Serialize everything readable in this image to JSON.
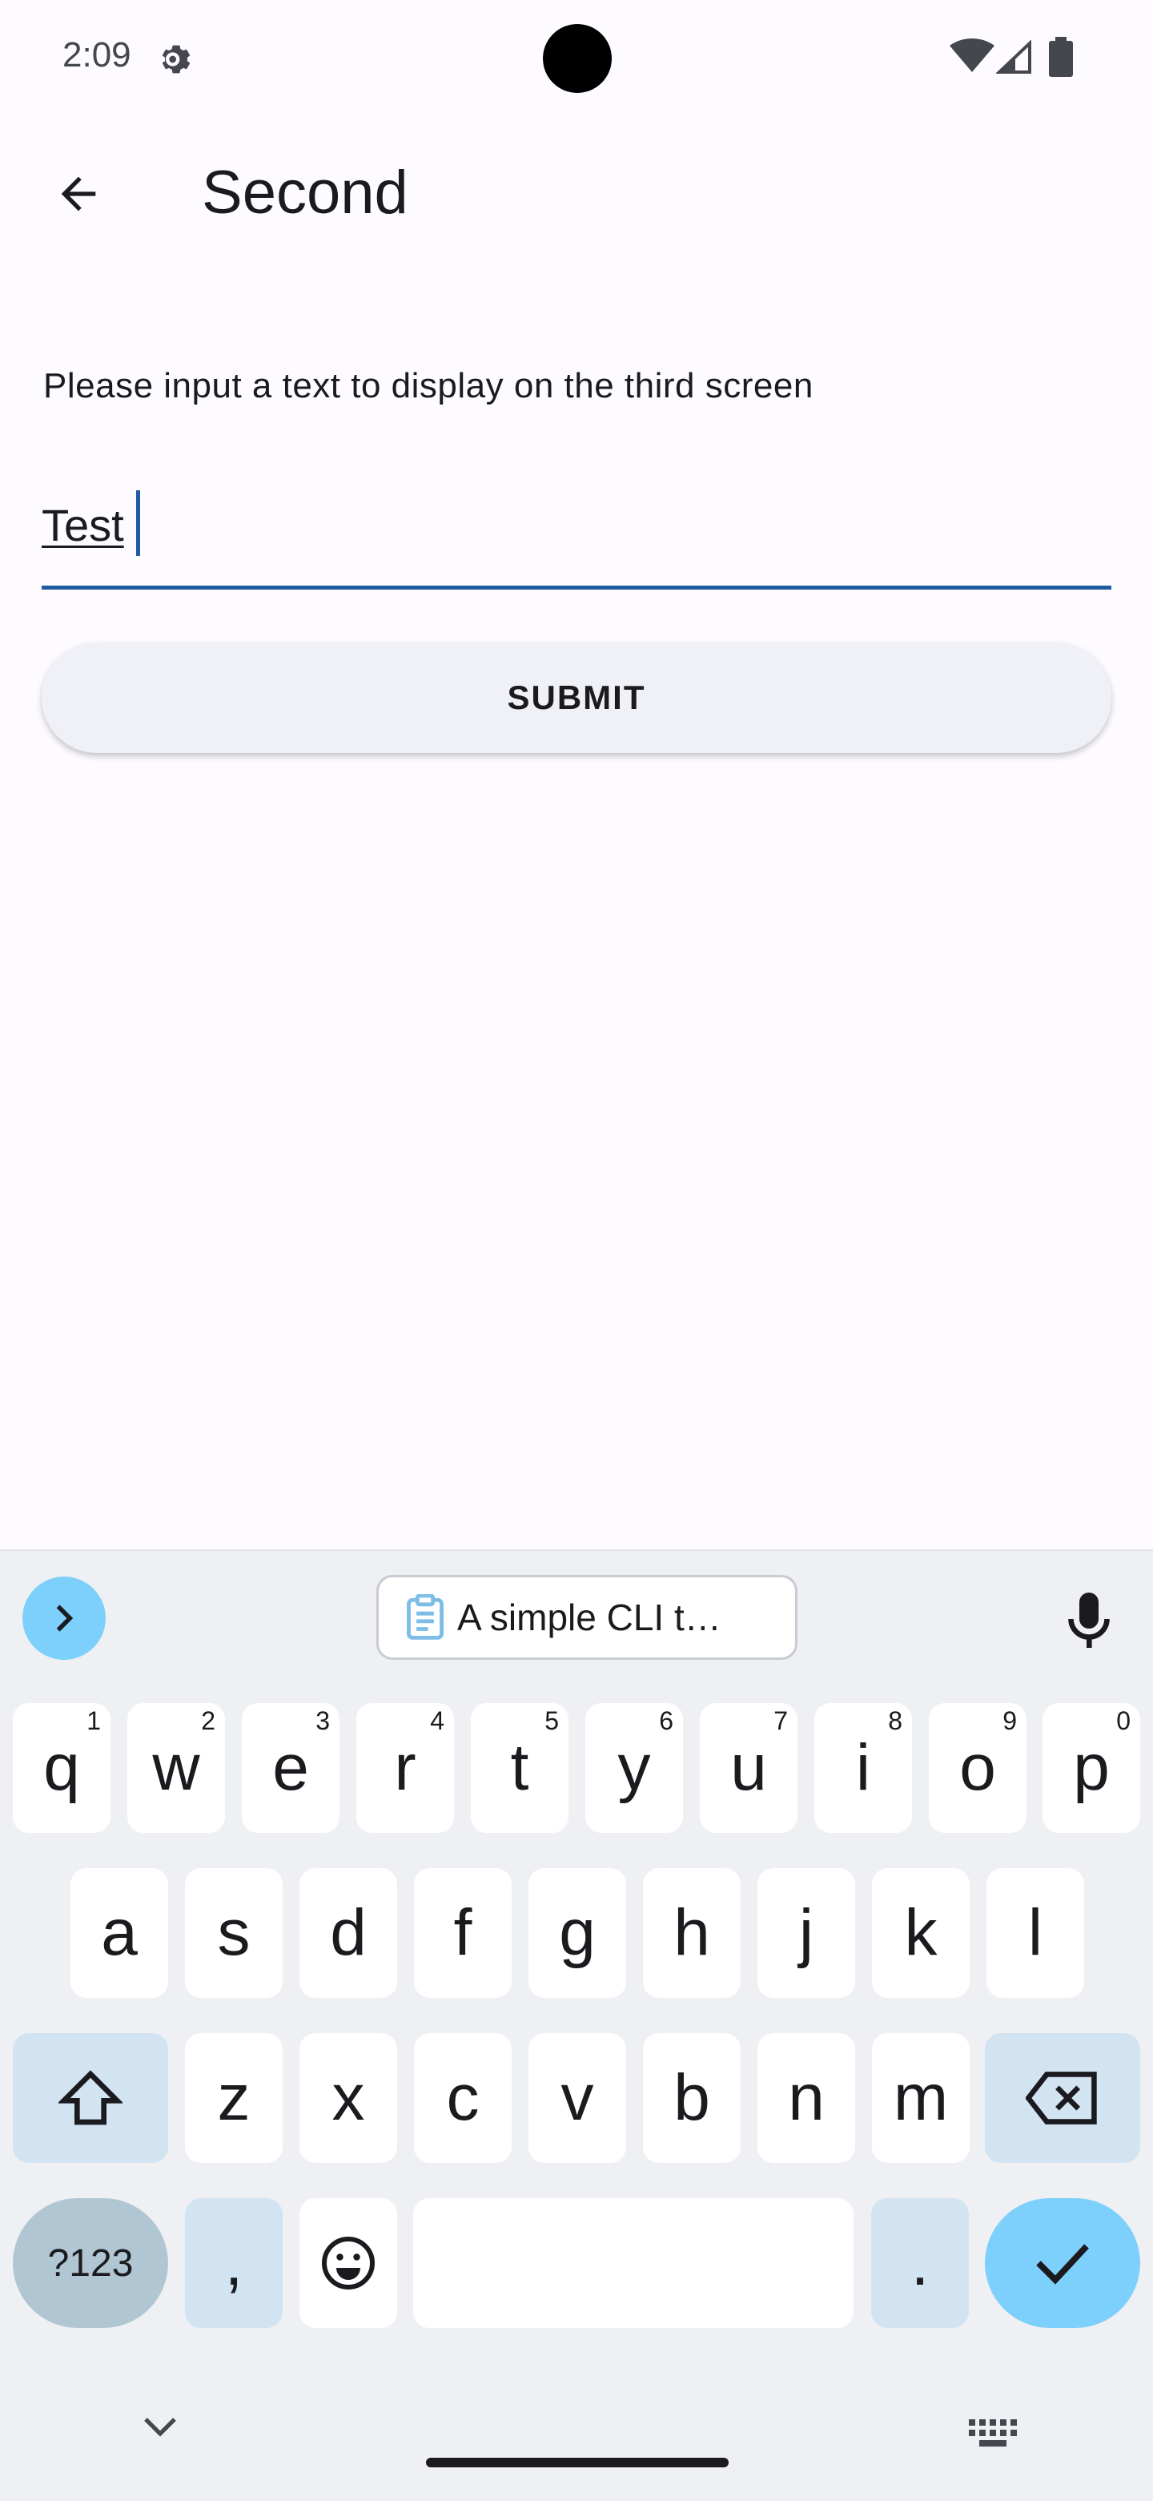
{
  "status_bar": {
    "time": "2:09",
    "icons": [
      "gear-icon",
      "wifi-icon",
      "signal-icon",
      "battery-icon"
    ]
  },
  "app_bar": {
    "title": "Second",
    "back_icon": "arrow-back-icon"
  },
  "content": {
    "prompt": "Please input a text to display on the third screen",
    "input_value": "Test",
    "submit_label": "SUBMIT"
  },
  "keyboard": {
    "clipboard_suggestion": "A simple CLI t…",
    "row1": [
      {
        "k": "q",
        "h": "1"
      },
      {
        "k": "w",
        "h": "2"
      },
      {
        "k": "e",
        "h": "3"
      },
      {
        "k": "r",
        "h": "4"
      },
      {
        "k": "t",
        "h": "5"
      },
      {
        "k": "y",
        "h": "6"
      },
      {
        "k": "u",
        "h": "7"
      },
      {
        "k": "i",
        "h": "8"
      },
      {
        "k": "o",
        "h": "9"
      },
      {
        "k": "p",
        "h": "0"
      }
    ],
    "row2": [
      "a",
      "s",
      "d",
      "f",
      "g",
      "h",
      "j",
      "k",
      "l"
    ],
    "row3": [
      "z",
      "x",
      "c",
      "v",
      "b",
      "n",
      "m"
    ],
    "symbols_label": "?123",
    "comma_label": ",",
    "period_label": "."
  },
  "colors": {
    "accent": "#1f5ca0",
    "keyboard_bg": "#eff0f3",
    "action_key": "#7dd0fb",
    "special_key": "#d2e3f2"
  }
}
